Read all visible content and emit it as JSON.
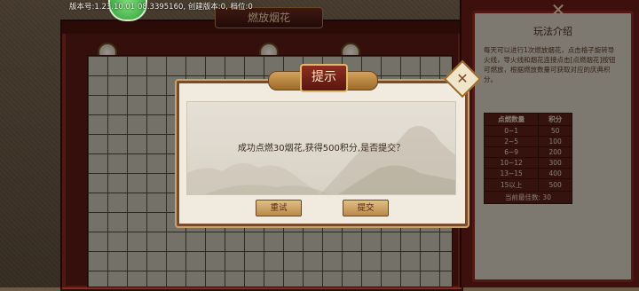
{
  "version_text": "版本号:1.23.10.01  08.3395160,  创建版本:0, 档位:0",
  "board": {
    "title": "燃放烟花"
  },
  "rules_panel": {
    "title": "玩法介绍",
    "description": "每天可以进行1次燃放烟花，点击格子旋转导火线，导火线和烟花连接点击[点燃烟花]按钮可燃放，根据燃放数量可获取对应的庆典积分。",
    "table_headers": [
      "点燃数量",
      "积分"
    ],
    "table_rows": [
      [
        "0~1",
        "50"
      ],
      [
        "2~5",
        "100"
      ],
      [
        "6~9",
        "200"
      ],
      [
        "10~12",
        "300"
      ],
      [
        "13~15",
        "400"
      ],
      [
        "15以上",
        "500"
      ]
    ],
    "best_label": "当前最佳数: 30"
  },
  "dialog": {
    "title": "提示",
    "message": "成功点燃30烟花,获得500积分,是否提交？",
    "retry_label": "重试",
    "submit_label": "提交"
  },
  "icons": {
    "close": "close-icon",
    "dialog_close": "close-icon"
  },
  "colors": {
    "frame_red": "#6a1d17",
    "dialog_bg": "#f1ebdf",
    "button_gold": "#c99a56"
  }
}
